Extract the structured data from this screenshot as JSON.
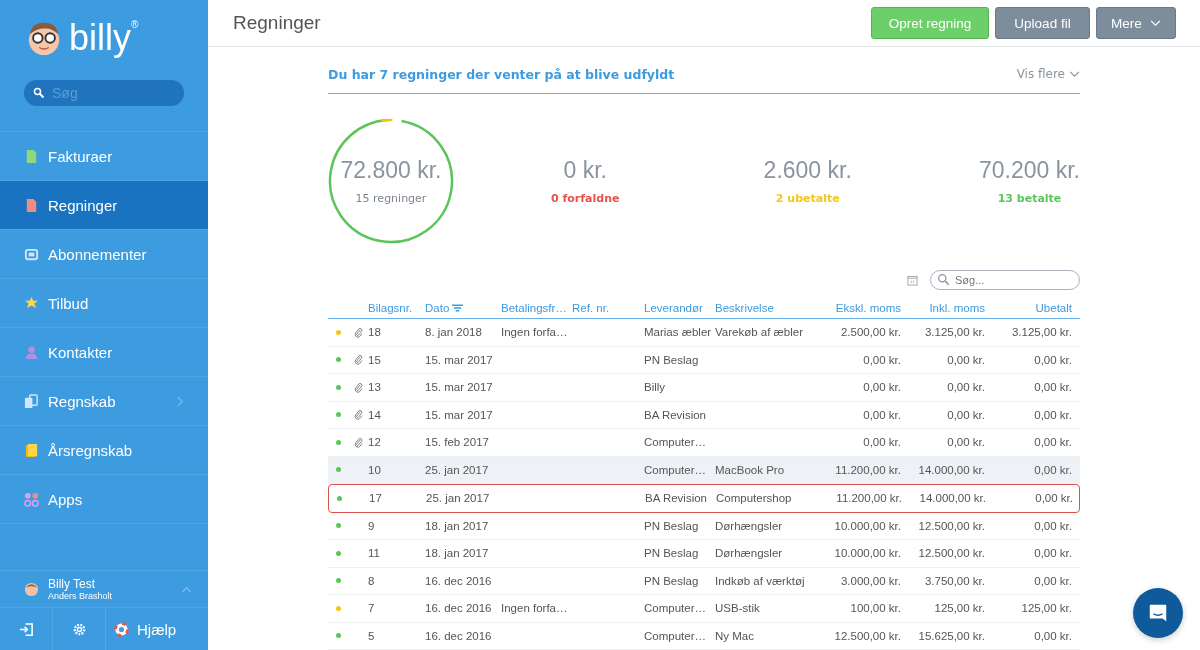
{
  "sidebar": {
    "logo": "billy$^{®}$",
    "search": {
      "placeholder": "Søg"
    },
    "items": [
      {
        "label": "Fakturaer",
        "kind": "invoice",
        "selected": false,
        "has_submenu": false
      },
      {
        "label": "Regninger",
        "kind": "bill",
        "selected": true,
        "has_submenu": false
      },
      {
        "label": "Abonnementer",
        "kind": "subscription",
        "selected": false,
        "has_submenu": false
      },
      {
        "label": "Tilbud",
        "kind": "star",
        "selected": false,
        "has_submenu": false
      },
      {
        "label": "Kontakter",
        "kind": "person",
        "selected": false,
        "has_submenu": false
      },
      {
        "label": "Regnskab",
        "kind": "ledger",
        "selected": false,
        "has_submenu": true
      },
      {
        "label": "Årsregnskab",
        "kind": "annual",
        "selected": false,
        "has_submenu": false
      },
      {
        "label": "Apps",
        "kind": "apps",
        "selected": false,
        "has_submenu": false
      }
    ],
    "user": {
      "name": "Billy Test",
      "subtitle": "Anders Brasholt"
    },
    "help": "Hjælp"
  },
  "header": {
    "title": "Regninger",
    "buttons": [
      {
        "label": "Opret regning",
        "kind": "primary"
      },
      {
        "label": "Upload fil",
        "kind": "secondary"
      },
      {
        "label": "Mere",
        "kind": "dropdown"
      }
    ]
  },
  "banner": {
    "text": "Du har 7 regninger der venter på at blive udfyldt",
    "link": "Vis flere"
  },
  "summary": {
    "total": {
      "amount": "72.800 kr.",
      "label": "15 regninger"
    },
    "stats": [
      {
        "amount": "0 kr.",
        "label": "0 forfaldne",
        "color": "#e8524a"
      },
      {
        "amount": "2.600 kr.",
        "label": "2 ubetalte",
        "color": "#f5c518"
      },
      {
        "amount": "70.200 kr.",
        "label": "13 betalte",
        "color": "#5cc45a"
      }
    ]
  },
  "table": {
    "search": {
      "placeholder": "Søg..."
    },
    "columns": [
      {
        "label": "Bilagsnr.",
        "sorted": false
      },
      {
        "label": "Dato",
        "sorted": true
      },
      {
        "label": "Betalingsfr…",
        "sorted": false
      },
      {
        "label": "Ref. nr.",
        "sorted": false
      },
      {
        "label": "Leverandør",
        "sorted": false
      },
      {
        "label": "Beskrivelse",
        "sorted": false
      },
      {
        "label": "Ekskl. moms",
        "sorted": false
      },
      {
        "label": "Inkl. moms",
        "sorted": false
      },
      {
        "label": "Ubetalt",
        "sorted": false
      }
    ],
    "rows": [
      {
        "color": "#f5c518",
        "attachment": true,
        "hovered": false,
        "highlighted": false,
        "cells": [
          "18",
          "8. jan 2018",
          "Ingen forfa…",
          "",
          "Marias æbler",
          "Varekøb af æbler",
          "2.500,00 kr.",
          "3.125,00 kr.",
          "3.125,00 kr."
        ]
      },
      {
        "color": "#5cc45a",
        "attachment": true,
        "hovered": false,
        "highlighted": false,
        "cells": [
          "15",
          "15. mar 2017",
          "",
          "",
          "PN Beslag",
          "",
          "0,00 kr.",
          "0,00 kr.",
          "0,00 kr."
        ]
      },
      {
        "color": "#5cc45a",
        "attachment": true,
        "hovered": false,
        "highlighted": false,
        "cells": [
          "13",
          "15. mar 2017",
          "",
          "",
          "Billy",
          "",
          "0,00 kr.",
          "0,00 kr.",
          "0,00 kr."
        ]
      },
      {
        "color": "#5cc45a",
        "attachment": true,
        "hovered": false,
        "highlighted": false,
        "cells": [
          "14",
          "15. mar 2017",
          "",
          "",
          "BA Revision",
          "",
          "0,00 kr.",
          "0,00 kr.",
          "0,00 kr."
        ]
      },
      {
        "color": "#5cc45a",
        "attachment": true,
        "hovered": false,
        "highlighted": false,
        "cells": [
          "12",
          "15. feb 2017",
          "",
          "",
          "Computer…",
          "",
          "0,00 kr.",
          "0,00 kr.",
          "0,00 kr."
        ]
      },
      {
        "color": "#5cc45a",
        "attachment": false,
        "hovered": true,
        "highlighted": false,
        "cells": [
          "10",
          "25. jan 2017",
          "",
          "",
          "Computer…",
          "MacBook Pro",
          "11.200,00 kr.",
          "14.000,00 kr.",
          "0,00 kr."
        ]
      },
      {
        "color": "#5cc45a",
        "attachment": false,
        "hovered": false,
        "highlighted": true,
        "cells": [
          "17",
          "25. jan 2017",
          "",
          "",
          "BA Revision",
          "Computershop",
          "11.200,00 kr.",
          "14.000,00 kr.",
          "0,00 kr."
        ]
      },
      {
        "color": "#5cc45a",
        "attachment": false,
        "hovered": false,
        "highlighted": false,
        "cells": [
          "9",
          "18. jan 2017",
          "",
          "",
          "PN Beslag",
          "Dørhængsler",
          "10.000,00 kr.",
          "12.500,00 kr.",
          "0,00 kr."
        ]
      },
      {
        "color": "#5cc45a",
        "attachment": false,
        "hovered": false,
        "highlighted": false,
        "cells": [
          "11",
          "18. jan 2017",
          "",
          "",
          "PN Beslag",
          "Dørhængsler",
          "10.000,00 kr.",
          "12.500,00 kr.",
          "0,00 kr."
        ]
      },
      {
        "color": "#5cc45a",
        "attachment": false,
        "hovered": false,
        "highlighted": false,
        "cells": [
          "8",
          "16. dec 2016",
          "",
          "",
          "PN Beslag",
          "Indkøb af værktøj",
          "3.000,00 kr.",
          "3.750,00 kr.",
          "0,00 kr."
        ]
      },
      {
        "color": "#f5c518",
        "attachment": false,
        "hovered": false,
        "highlighted": false,
        "cells": [
          "7",
          "16. dec 2016",
          "Ingen forfa…",
          "",
          "Computer…",
          "USB-stik",
          "100,00 kr.",
          "125,00 kr.",
          "125,00 kr."
        ]
      },
      {
        "color": "#5cc45a",
        "attachment": false,
        "hovered": false,
        "highlighted": false,
        "cells": [
          "5",
          "16. dec 2016",
          "",
          "",
          "Computer…",
          "Ny Mac",
          "12.500,00 kr.",
          "15.625,00 kr.",
          "0,00 kr."
        ]
      }
    ]
  }
}
